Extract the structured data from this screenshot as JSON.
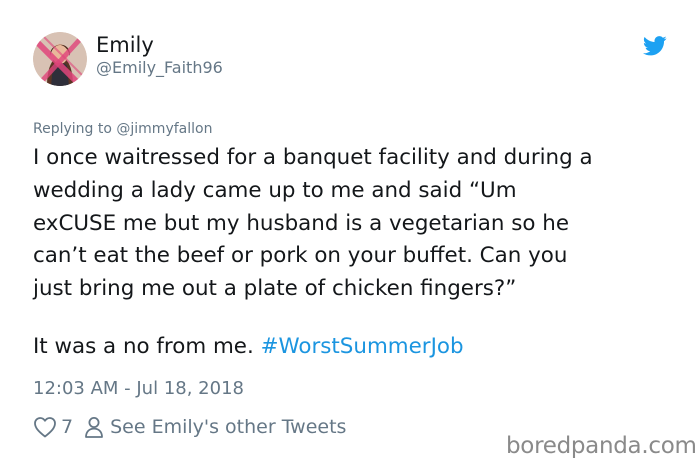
{
  "tweet": {
    "display_name": "Emily",
    "handle": "@Emily_Faith96",
    "reply_prefix": "Replying to ",
    "reply_to": "@jimmyfallon",
    "body_lines": [
      "I once waitressed for a banquet facility and during a",
      "wedding a lady came up to me and said “Um",
      "exCUSE me but my husband is a vegetarian so he",
      "can’t eat the beef or pork on your buffet. Can you",
      "just bring me out a plate of chicken fingers?”"
    ],
    "closing_text": "It was a no from me. ",
    "hashtag": "#WorstSummerJob",
    "timestamp": "12:03 AM - Jul 18, 2018",
    "like_count": "7",
    "other_tweets_link": "See Emily's other Tweets"
  },
  "watermark": "boredpanda.com",
  "icons": {
    "brand": "twitter-bird-icon",
    "like": "heart-icon",
    "profile": "person-icon"
  },
  "colors": {
    "link_blue": "#1b95e0",
    "secondary_gray": "#657786",
    "text_dark": "#14171a",
    "twitter_blue": "#1da1f2"
  }
}
